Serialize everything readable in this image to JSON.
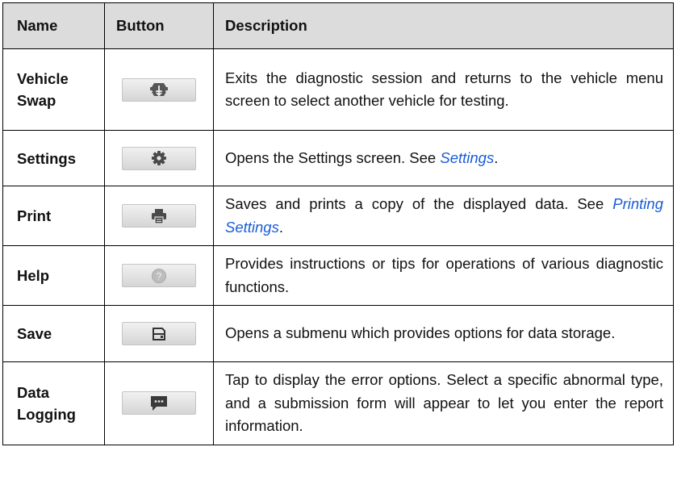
{
  "headers": {
    "name": "Name",
    "button": "Button",
    "description": "Description"
  },
  "rows": [
    {
      "name_lines": [
        "Vehicle",
        "Swap"
      ],
      "icon": "vehicle-swap-icon",
      "desc": "Exits the diagnostic session and returns to the vehicle menu screen to select another vehicle for testing."
    },
    {
      "name_lines": [
        "Settings"
      ],
      "icon": "gear-icon",
      "desc_before": "Opens the Settings screen. See ",
      "desc_link": "Settings",
      "desc_after": "."
    },
    {
      "name_lines": [
        "Print"
      ],
      "icon": "printer-icon",
      "desc_before": "Saves and prints a copy of the displayed data. See ",
      "desc_link": "Printing Settings",
      "desc_after": "."
    },
    {
      "name_lines": [
        "Help"
      ],
      "icon": "help-icon",
      "desc": "Provides instructions or tips for operations of various diagnostic functions."
    },
    {
      "name_lines": [
        "Save"
      ],
      "icon": "save-icon",
      "desc": "Opens a submenu which provides options for data storage."
    },
    {
      "name_lines": [
        "Data",
        "Logging"
      ],
      "icon": "chat-bubble-icon",
      "desc": "Tap to display the error options. Select a specific abnormal type, and a submission form will appear to let you enter the report information."
    }
  ]
}
